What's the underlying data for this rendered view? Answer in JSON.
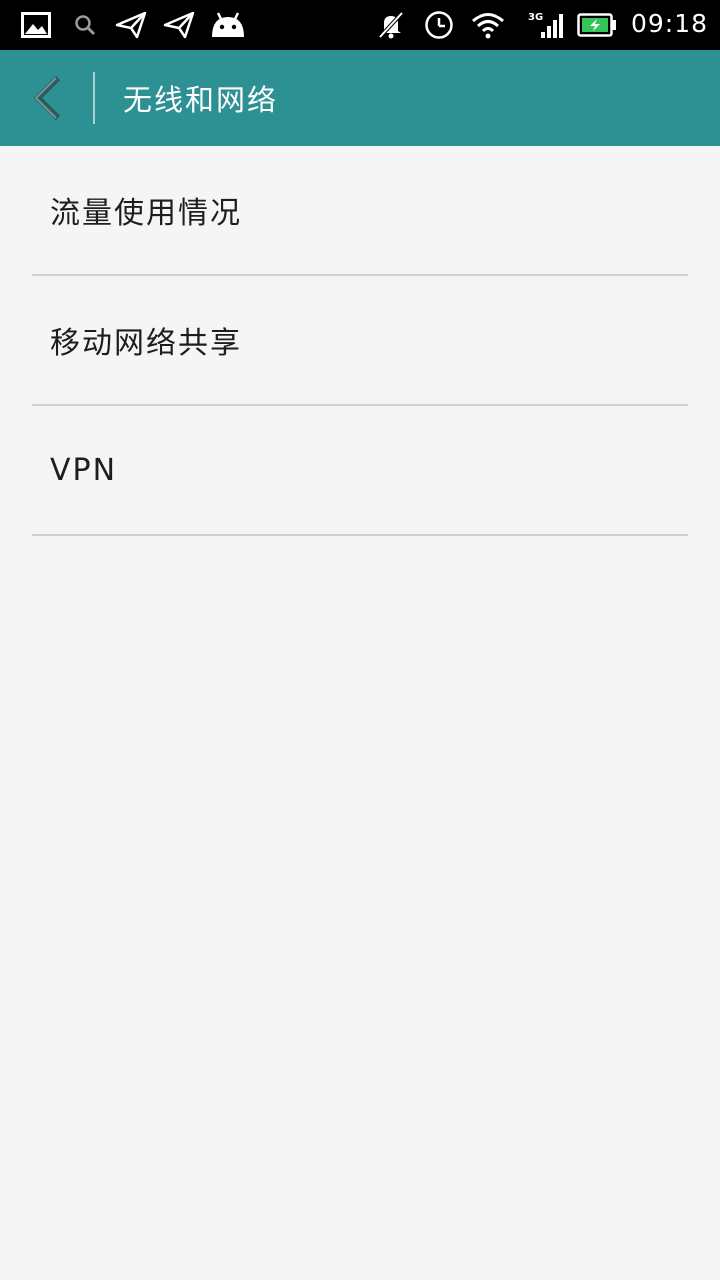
{
  "status_bar": {
    "time": "09:18",
    "network_type": "3G",
    "icons": [
      "image-icon",
      "search-icon",
      "send-icon",
      "send-icon",
      "android-icon",
      "mute-icon",
      "alarm-icon",
      "wifi-icon",
      "signal-icon",
      "battery-charging-icon"
    ]
  },
  "header": {
    "title": "无线和网络",
    "back_icon": "chevron-left-icon",
    "background": "#2d9093"
  },
  "settings": {
    "items": [
      {
        "label": "流量使用情况"
      },
      {
        "label": "移动网络共享"
      },
      {
        "label": "VPN"
      }
    ]
  }
}
